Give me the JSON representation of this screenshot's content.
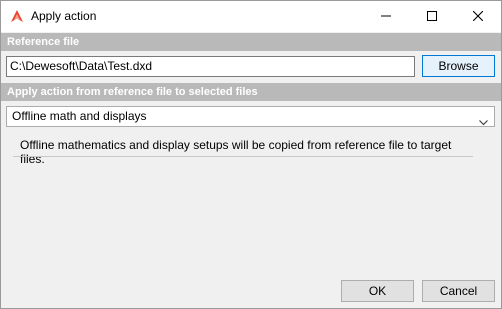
{
  "window": {
    "title": "Apply action",
    "icon": "dewesoft-logo-icon",
    "controls": [
      "minimize-icon",
      "maximize-icon",
      "close-icon"
    ]
  },
  "reference": {
    "header": "Reference file",
    "path_value": "C:\\Dewesoft\\Data\\Test.dxd",
    "browse_label": "Browse"
  },
  "apply": {
    "header": "Apply action from reference file to selected files",
    "selected_action": "Offline math and displays",
    "description": "Offline mathematics and display setups will be copied from reference file to target files."
  },
  "footer": {
    "ok_label": "OK",
    "cancel_label": "Cancel"
  },
  "colors": {
    "section_header_bg": "#b9b9b9",
    "logo_accent": "#e8452c",
    "focus_border": "#0078d7"
  }
}
